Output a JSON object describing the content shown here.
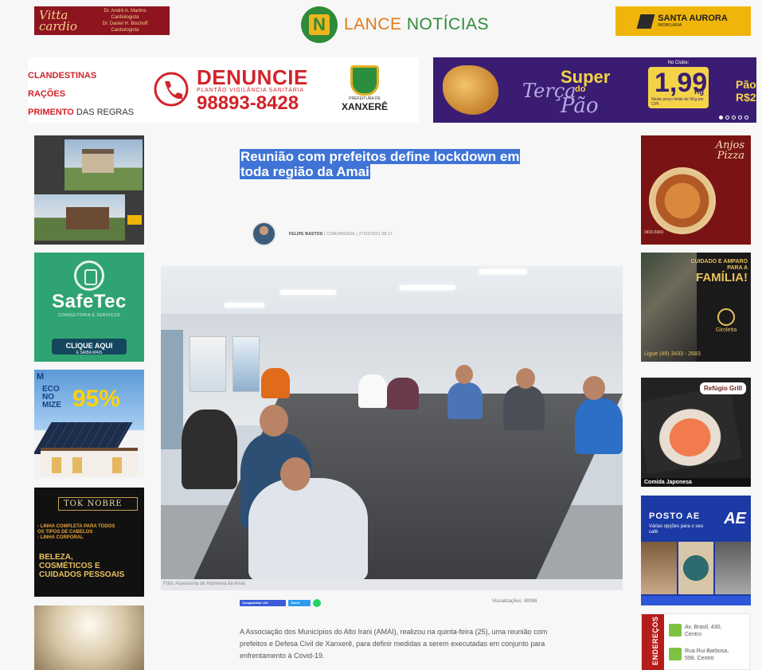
{
  "header": {
    "left_ad": {
      "logo_text": "Vitta cardio",
      "doctor_1": "Dr. André A. Martins",
      "doctor_1_role": "Cardiologista",
      "doctor_2": "Dr. Daniel H. Bischoff",
      "doctor_2_role": "Cardiologista"
    },
    "brand": {
      "mark": "N",
      "name_part1": "LANCE",
      "name_part2": "NOTÍCIAS"
    },
    "right_ad": {
      "name": "SANTA AURORA",
      "sub": "IMOBILIÁRIA"
    }
  },
  "banner_left": {
    "line1": "CLANDESTINAS",
    "line2": "RAÇÕES",
    "line3_bold": "PRIMENTO",
    "line3_rest": " DAS REGRAS",
    "title": "DENUNCIE",
    "subtitle": "PLANTÃO VIGILÂNCIA SANITÁRIA",
    "phone": "98893-8428",
    "crest_sub": "PREFEITURA DE",
    "crest_name": "XANXERÊ"
  },
  "banner_right": {
    "super": "Super",
    "terca": "Terça",
    "do": "do",
    "pao": "Pão",
    "club_label": "No Clube:",
    "price": "1,99",
    "unit": "Kg",
    "note": "Neste preço limite de 5Kg por CPF",
    "cut_text_1": "Pão",
    "cut_text_2": "R$2",
    "slide_active_index": 1,
    "slide_count": 5
  },
  "left_ads": {
    "safetec": {
      "name": "SafeTec",
      "sub": "CONSULTORIA E SERVIÇOS",
      "button": "CLIQUE AQUI",
      "button_sub": "E SAIBA MAIS"
    },
    "solar": {
      "brand": "M",
      "eco_1": "ECO",
      "eco_2": "NO",
      "eco_3": "MIZE",
      "pct": "95%"
    },
    "tok": {
      "logo": "TOK NOBRE",
      "line_1": "- LINHA COMPLETA PARA TODOS",
      "line_2": "OS TIPOS DE CABELOS",
      "line_3": "- LINHA CORPORAL",
      "big_1": "BELEZA,",
      "big_2": "COSMÉTICOS E",
      "big_3": "CUIDADOS PESSOAIS"
    }
  },
  "right_ads": {
    "pizza": {
      "title_1": "Anjos",
      "title_2": "Pizza",
      "phone": "3433-5669"
    },
    "giroletta": {
      "line_1": "CUIDADO E AMPARO",
      "line_2": "PARA A",
      "line_3": "FAMÍLIA!",
      "logo": "Giroletta",
      "phone": "Ligue (49) 3433 - 2683"
    },
    "sushi": {
      "logo": "Refúgio Grill",
      "label": "Comida Japonesa"
    },
    "posto": {
      "title": "POSTO AE",
      "sub": "Várias opções para o seu café",
      "logo": "AE"
    },
    "enderecos": {
      "tab": "ENDEREÇOS",
      "item_1_line_1": "Av. Brasil, 430,",
      "item_1_line_2": "Centro",
      "item_2_line_1": "Rua Rui Barbosa,",
      "item_2_line_2": "598, Centro"
    }
  },
  "article": {
    "title": "Reunião com prefeitos define lockdown em toda região da Amai",
    "author": "FELIPE BASTOS",
    "category": "COMUNIDADE",
    "date": "27/02/2021 08:17",
    "photo_credit": "Foto: Assessoria de Imprensa da Amai",
    "share_facebook": "Compartilhar 152",
    "share_twitter": "Tweet",
    "views": "Visualizações: 48096",
    "body": "A Associação dos Municípios do Alto Irani (AMAI), realizou na quinta-feira (25), uma reunião com prefeitos e Defesa Civil de Xanxerê, para definir medidas a serem executadas em conjunto para enfrentamento à Covid-19."
  }
}
